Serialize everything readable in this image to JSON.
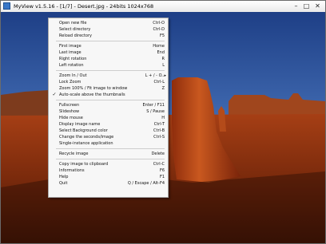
{
  "window": {
    "title": "MyView v1.5.16 - [1/7] - Desert.jpg - 24bits  1024x768",
    "minimize_glyph": "–",
    "maximize_glyph": "□",
    "close_glyph": "✕"
  },
  "menu": {
    "items": [
      {
        "label": "Open new file",
        "shortcut": "Ctrl-O",
        "checked": ""
      },
      {
        "label": "Select directory",
        "shortcut": "Ctrl-D",
        "checked": ""
      },
      {
        "label": "Reload directory",
        "shortcut": "F5",
        "checked": ""
      },
      {
        "label": "First image",
        "shortcut": "Home",
        "checked": ""
      },
      {
        "label": "Last image",
        "shortcut": "End",
        "checked": ""
      },
      {
        "label": "Right rotation",
        "shortcut": "R",
        "checked": ""
      },
      {
        "label": "Left rotation",
        "shortcut": "L",
        "checked": ""
      },
      {
        "label": "Zoom In / Out",
        "shortcut": "L + / - O..▸",
        "checked": ""
      },
      {
        "label": "Lock Zoom",
        "shortcut": "Ctrl-L",
        "checked": ""
      },
      {
        "label": "Zoom 100% / Fit image to window",
        "shortcut": "Z",
        "checked": ""
      },
      {
        "label": "Auto-scale above the thumbnails",
        "shortcut": "",
        "checked": "✓"
      },
      {
        "label": "Fullscreen",
        "shortcut": "Enter / F11",
        "checked": ""
      },
      {
        "label": "Slideshow",
        "shortcut": "S / Pause",
        "checked": ""
      },
      {
        "label": "Hide mouse",
        "shortcut": "H",
        "checked": ""
      },
      {
        "label": "Display image name",
        "shortcut": "Ctrl-T",
        "checked": ""
      },
      {
        "label": "Select Background color",
        "shortcut": "Ctrl-B",
        "checked": ""
      },
      {
        "label": "Change the seconds/image",
        "shortcut": "Ctrl-S",
        "checked": ""
      },
      {
        "label": "Single-instance application",
        "shortcut": "",
        "checked": ""
      },
      {
        "label": "Recycle image",
        "shortcut": "Delete",
        "checked": ""
      },
      {
        "label": "Copy image to clipboard",
        "shortcut": "Ctrl-C",
        "checked": ""
      },
      {
        "label": "Informations",
        "shortcut": "F6",
        "checked": ""
      },
      {
        "label": "Help",
        "shortcut": "F1",
        "checked": ""
      },
      {
        "label": "Quit",
        "shortcut": "Q / Escape / Alt-F4",
        "checked": ""
      }
    ]
  }
}
